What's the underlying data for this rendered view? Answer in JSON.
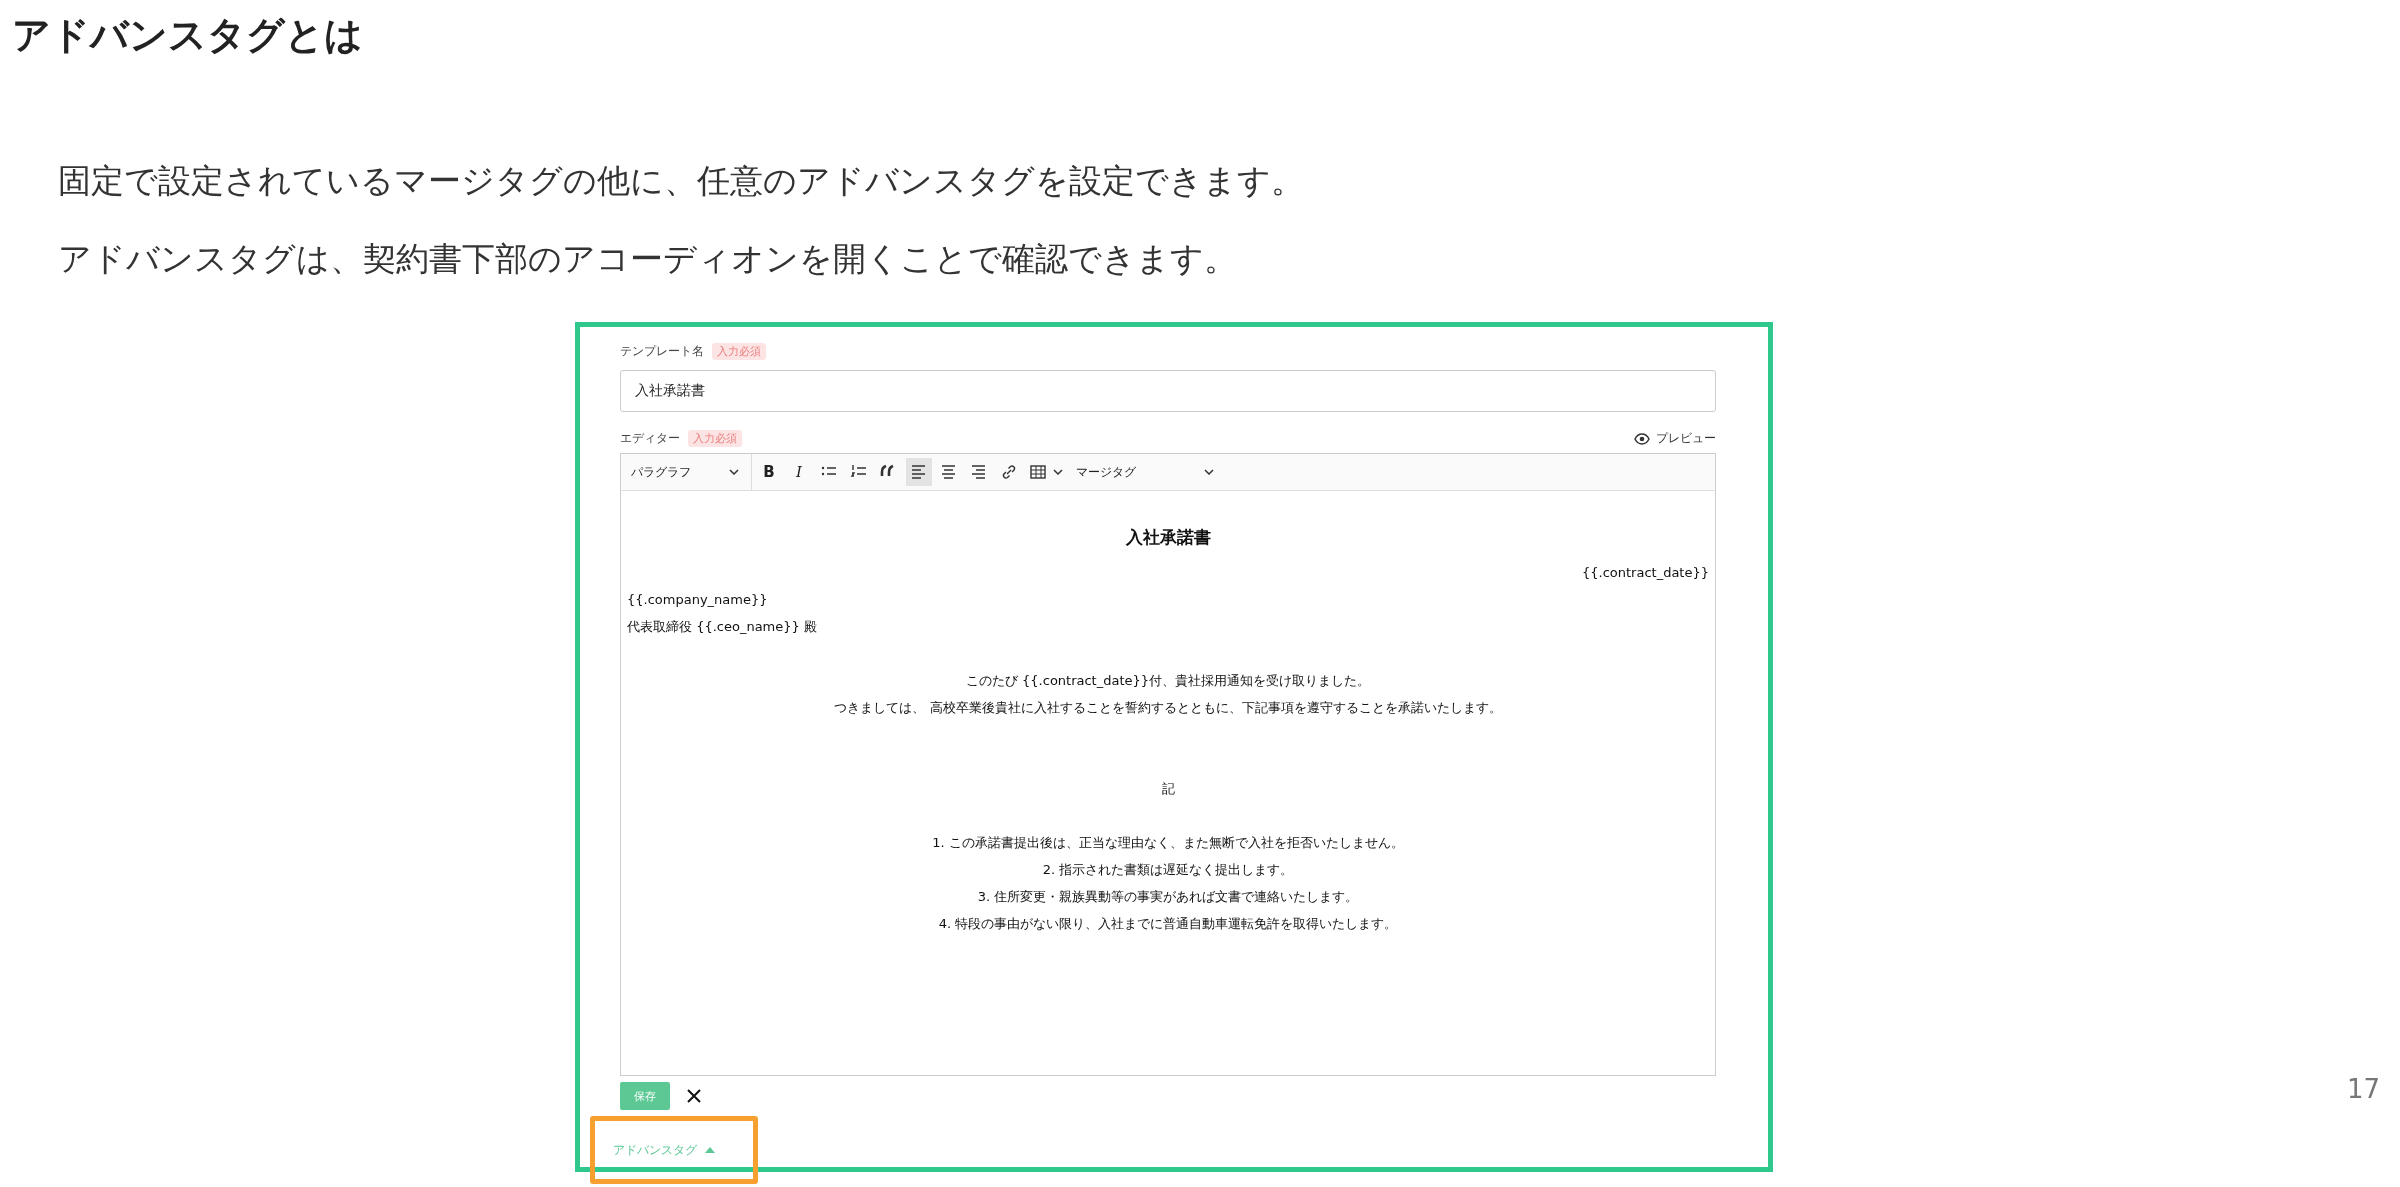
{
  "heading": "アドバンスタグとは",
  "paragraphs": [
    "固定で設定されているマージタグの他に、任意のアドバンスタグを設定できます。",
    "アドバンスタグは、契約書下部のアコーディオンを開くことで確認できます。"
  ],
  "page_number": "17",
  "form": {
    "template_name": {
      "label": "テンプレート名",
      "badge": "入力必須",
      "value": "入社承諾書"
    },
    "editor": {
      "label": "エディター",
      "badge": "入力必須",
      "preview": "プレビュー",
      "toolbar": [
        {
          "kind": "select",
          "label": "パラグラフ",
          "selected": false
        },
        {
          "kind": "bold",
          "label": "B",
          "selected": false
        },
        {
          "kind": "italic",
          "label": "I",
          "selected": false
        },
        {
          "kind": "bullets",
          "selected": false
        },
        {
          "kind": "numbers",
          "selected": false
        },
        {
          "kind": "quote",
          "selected": false
        },
        {
          "kind": "align-left",
          "selected": true
        },
        {
          "kind": "align-center",
          "selected": false
        },
        {
          "kind": "align-right",
          "selected": false
        },
        {
          "kind": "link",
          "selected": false
        },
        {
          "kind": "table",
          "selected": false
        },
        {
          "kind": "select",
          "label": "マージタグ",
          "selected": false
        }
      ],
      "document": [
        {
          "kind": "title",
          "text": "入社承諾書"
        },
        {
          "kind": "right",
          "text": "{{.contract_date}}"
        },
        {
          "kind": "left",
          "text": "{{.company_name}}"
        },
        {
          "kind": "left",
          "text": "代表取締役 {{.ceo_name}} 殿"
        },
        {
          "kind": "blank"
        },
        {
          "kind": "center",
          "text": "このたび {{.contract_date}}付、貴社採用通知を受け取りました。"
        },
        {
          "kind": "center",
          "text": "つきましては、 高校卒業後貴社に入社することを誓約するとともに、下記事項を遵守することを承諾いたします。"
        },
        {
          "kind": "blank"
        },
        {
          "kind": "blank"
        },
        {
          "kind": "center",
          "text": "記"
        },
        {
          "kind": "blank"
        },
        {
          "kind": "center",
          "text": "1. この承諾書提出後は、正当な理由なく、また無断で入社を拒否いたしません。"
        },
        {
          "kind": "center",
          "text": "2. 指示された書類は遅延なく提出します。"
        },
        {
          "kind": "center",
          "text": "3. 住所変更・親族異動等の事実があれば文書で連絡いたします。"
        },
        {
          "kind": "center",
          "text": "4. 特段の事由がない限り、入社までに普通自動車運転免許を取得いたします。"
        }
      ]
    },
    "save_button": "保存",
    "advanced_tags": {
      "label": "アドバンスタグ",
      "expanded": true
    }
  }
}
